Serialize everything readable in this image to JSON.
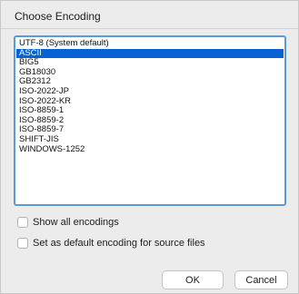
{
  "dialog": {
    "title": "Choose Encoding"
  },
  "encodings": {
    "items": [
      "UTF-8 (System default)",
      "ASCII",
      "BIG5",
      "GB18030",
      "GB2312",
      "ISO-2022-JP",
      "ISO-2022-KR",
      "ISO-8859-1",
      "ISO-8859-2",
      "ISO-8859-7",
      "SHIFT-JIS",
      "WINDOWS-1252"
    ],
    "selected": "ASCII"
  },
  "options": {
    "show_all_label": "Show all encodings",
    "show_all_checked": false,
    "set_default_label": "Set as default encoding for source files",
    "set_default_checked": false
  },
  "buttons": {
    "ok_label": "OK",
    "cancel_label": "Cancel"
  },
  "colors": {
    "selection": "#0862d6",
    "focus_ring": "#5b9bd5"
  }
}
